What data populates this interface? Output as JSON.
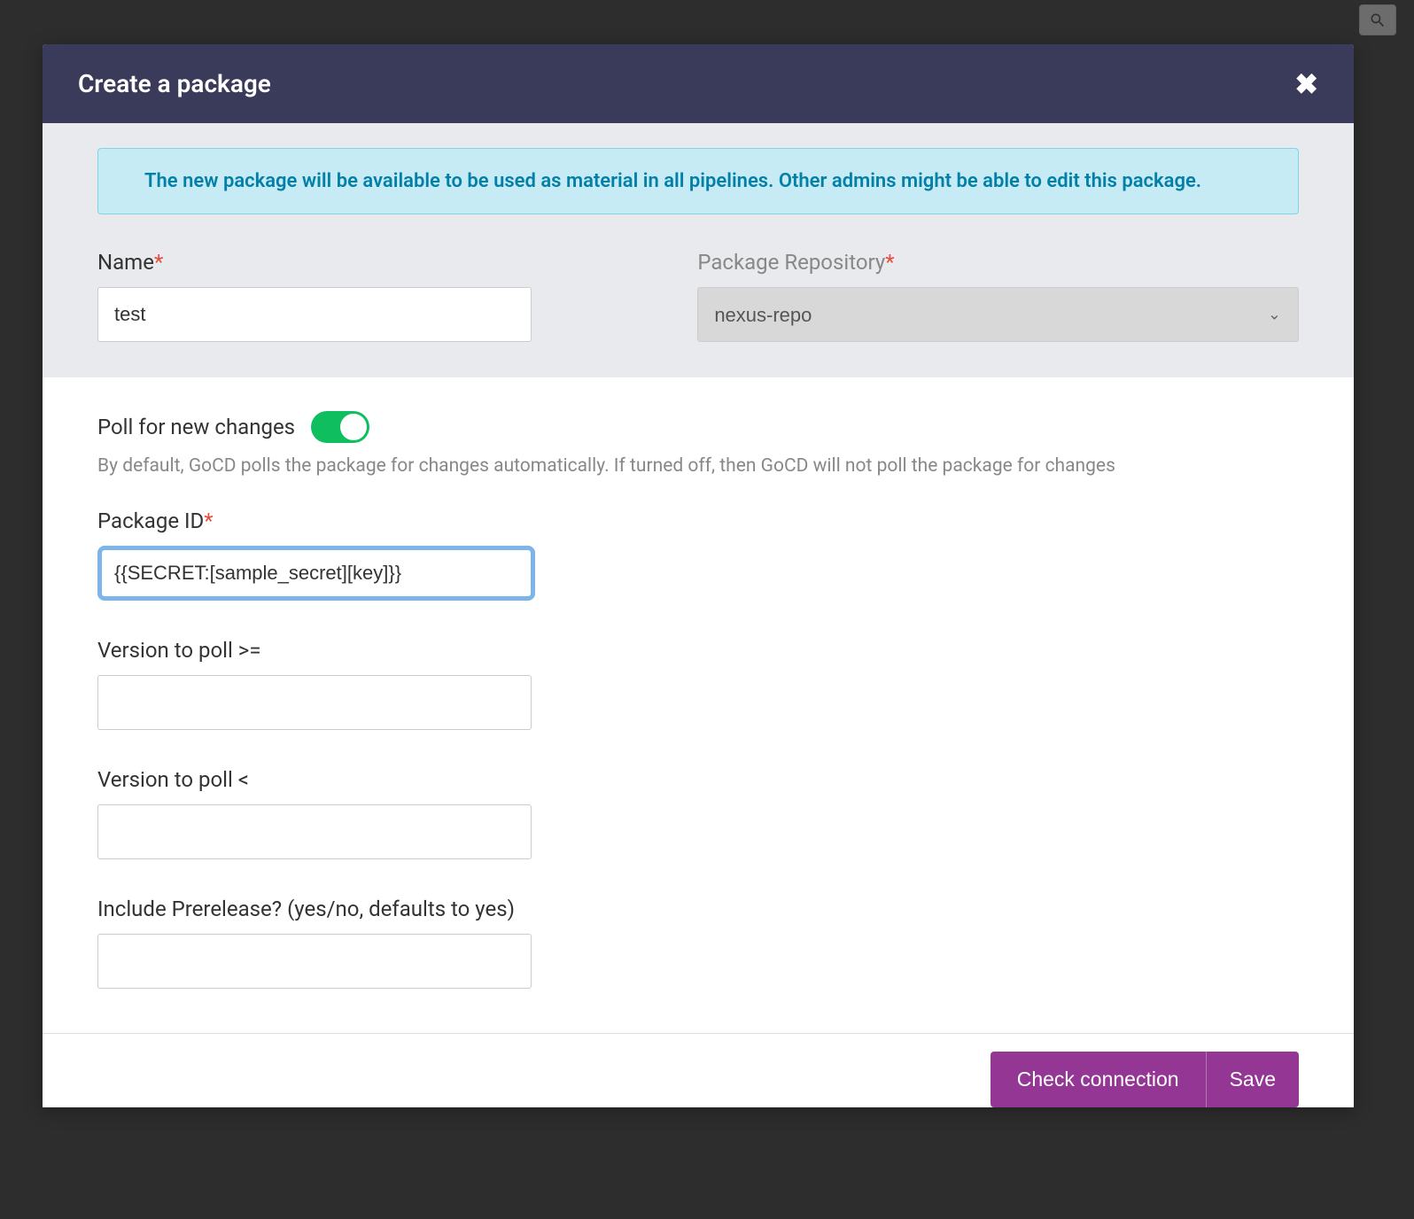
{
  "topbar": {
    "search_placeholder": "Search"
  },
  "modal": {
    "title": "Create a package",
    "info_banner": "The new package will be available to be used as material in all pipelines. Other admins might be able to edit this package."
  },
  "fields": {
    "name_label": "Name",
    "name_value": "test",
    "repo_label": "Package Repository",
    "repo_value": "nexus-repo",
    "poll_label": "Poll for new changes",
    "poll_enabled": true,
    "poll_help": "By default, GoCD polls the package for changes automatically. If turned off, then GoCD will not poll the package for changes",
    "package_id_label": "Package ID",
    "package_id_value": "{{SECRET:[sample_secret][key]}}",
    "version_gte_label": "Version to poll >=",
    "version_gte_value": "",
    "version_lt_label": "Version to poll <",
    "version_lt_value": "",
    "prerelease_label": "Include Prerelease? (yes/no, defaults to yes)",
    "prerelease_value": ""
  },
  "buttons": {
    "check": "Check connection",
    "save": "Save"
  }
}
